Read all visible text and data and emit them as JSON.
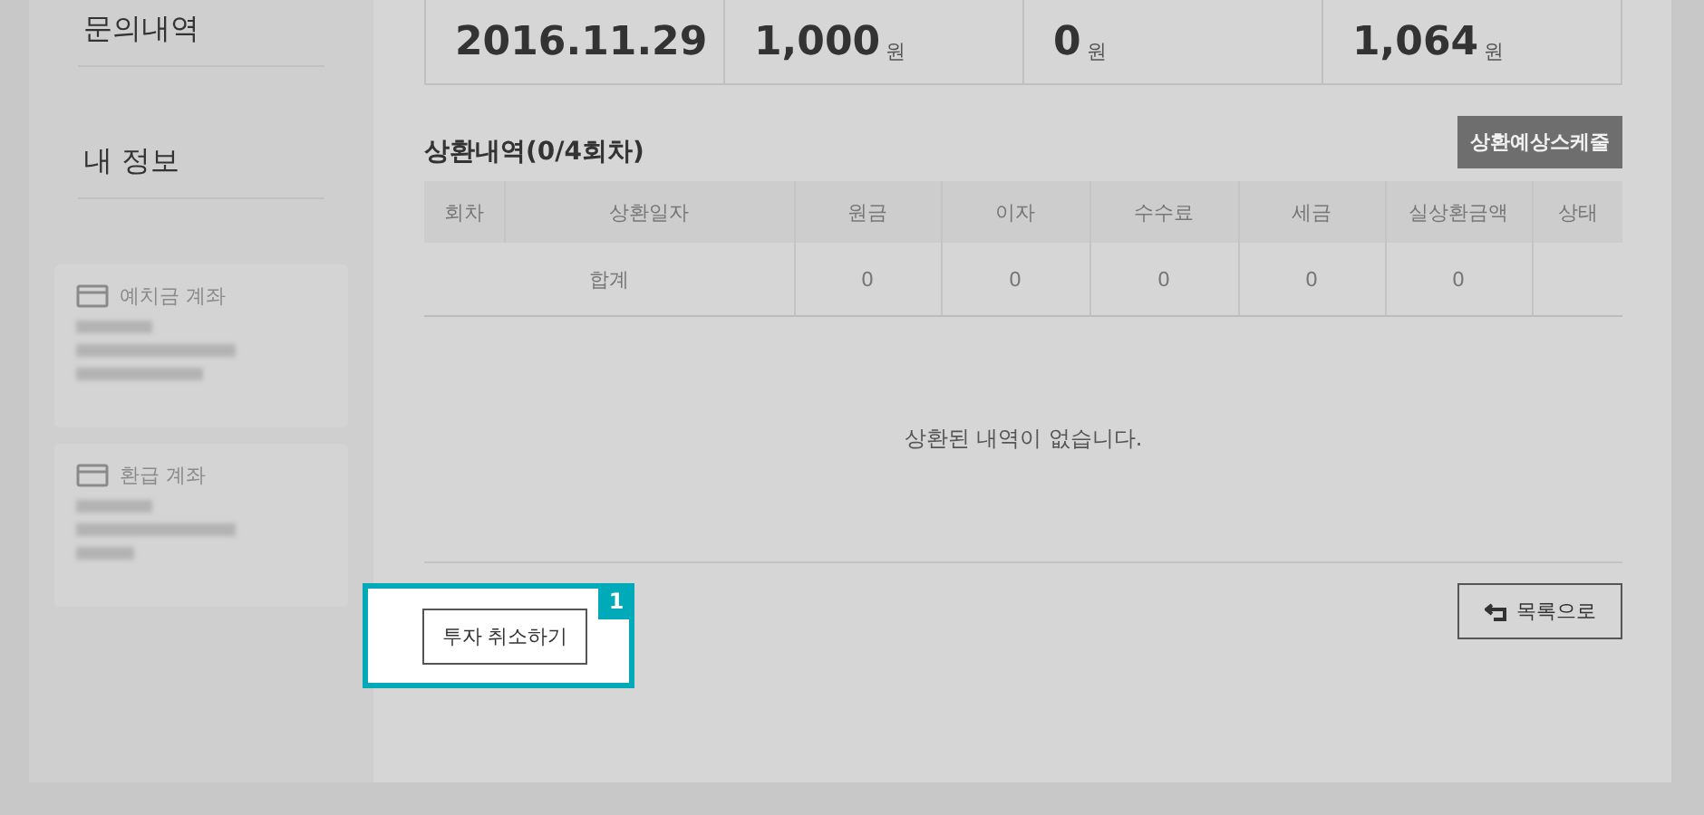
{
  "sidebar": {
    "menu": [
      {
        "label": "문의내역"
      },
      {
        "label": "내 정보"
      }
    ],
    "accounts": [
      {
        "title": "예치금 계좌"
      },
      {
        "title": "환급 계좌"
      }
    ]
  },
  "summary": [
    {
      "value": "2016.11.29"
    },
    {
      "value": "1,000",
      "unit": "원"
    },
    {
      "value": "0",
      "unit": "원"
    },
    {
      "value": "1,064",
      "unit": "원"
    }
  ],
  "repayment": {
    "title": "상환내역(0/4회차)",
    "schedule_button": "상환예상스케줄",
    "columns": [
      "회차",
      "상환일자",
      "원금",
      "이자",
      "수수료",
      "세금",
      "실상환금액",
      "상태"
    ],
    "total_row": {
      "label": "합계",
      "cells": [
        "0",
        "0",
        "0",
        "0",
        "0"
      ]
    },
    "empty_message": "상환된 내역이 없습니다."
  },
  "cancel_button": {
    "label": "투자 취소하기",
    "highlighted": true,
    "step": "1"
  },
  "back_button": {
    "label": "목록으로"
  }
}
